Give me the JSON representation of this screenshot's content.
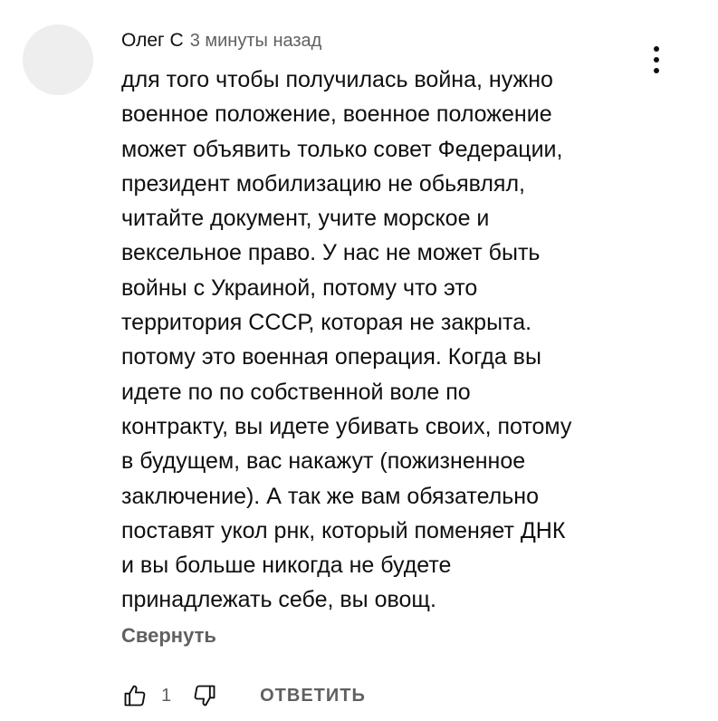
{
  "comment": {
    "author": "Олег С",
    "timestamp": "3 минуты назад",
    "text_lines": [
      "для того чтобы получилась война, нужно",
      "военное положение, военное положение",
      "может объявить только совет Федерации,",
      "президент мобилизацию не обьявлял,",
      "читайте документ, учите морское и",
      "вексельное право. У нас не может быть",
      "войны с Украиной, потому что это",
      "территория СССР, которая не закрыта.",
      "потому это военная операция. Когда вы",
      "идете по по собственной воле по",
      "контракту, вы идете убивать своих, потому",
      "в будущем, вас накажут (пожизненное",
      "заключение). А так же вам обязательно",
      "поставят укол рнк, который поменяет ДНК",
      "и вы больше никогда не будете",
      "принадлежать себе, вы овощ."
    ],
    "collapse_label": "Свернуть",
    "like_count": "1",
    "reply_label": "ОТВЕТИТЬ"
  },
  "icons": {
    "menu": "vertical-dots-icon",
    "like": "thumbs-up-icon",
    "dislike": "thumbs-down-icon"
  },
  "colors": {
    "text_primary": "#0f0f0f",
    "text_secondary": "#606060",
    "avatar_placeholder": "#eeeeee"
  }
}
